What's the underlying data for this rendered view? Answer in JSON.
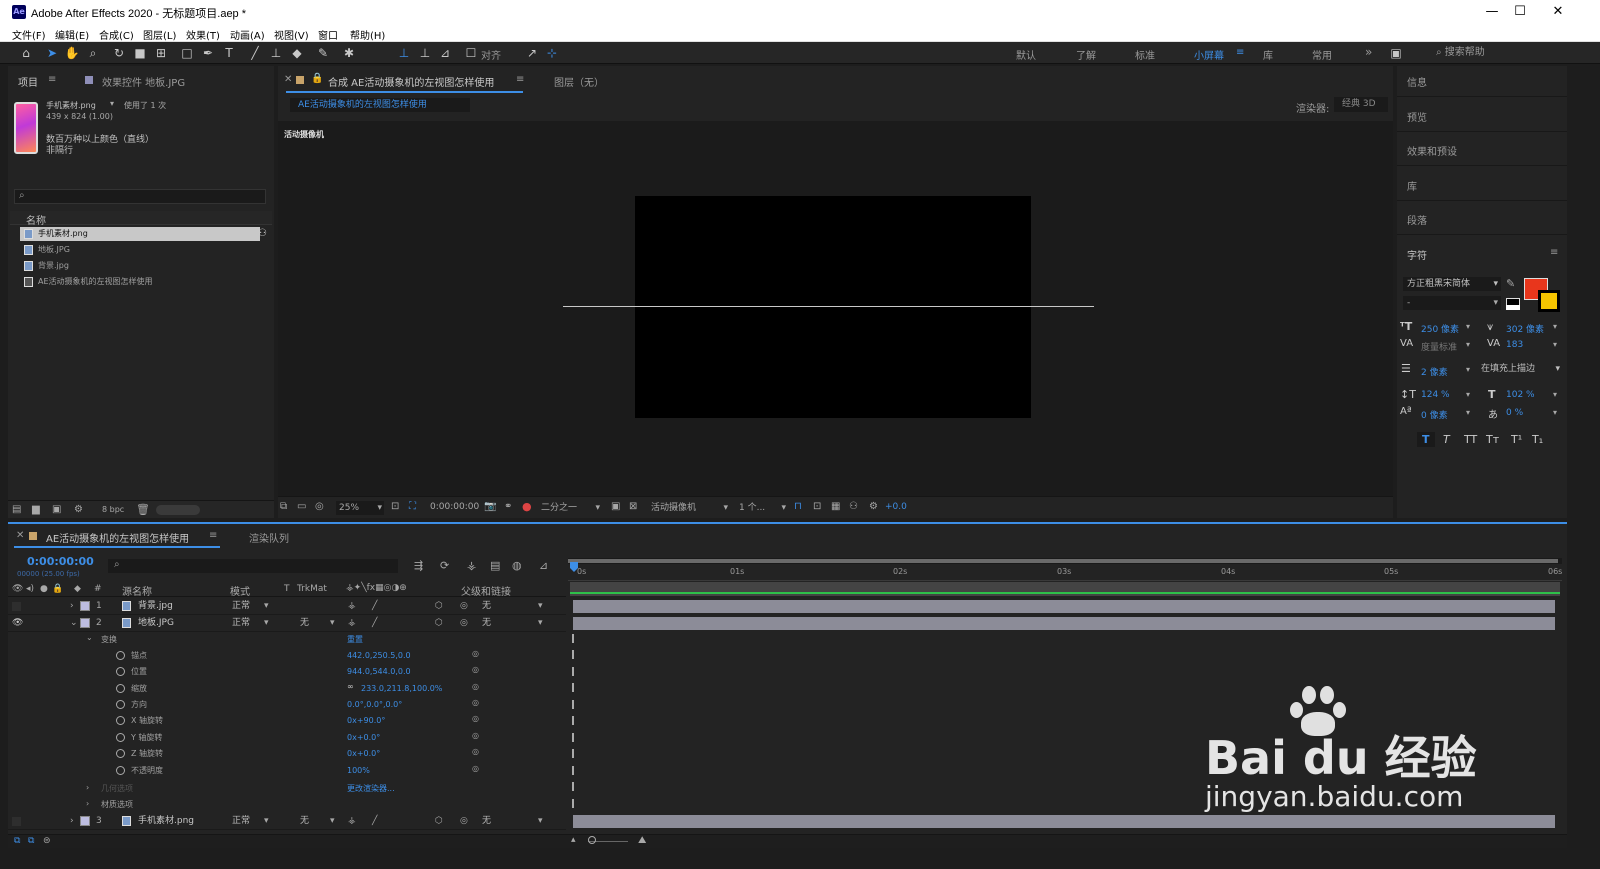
{
  "window": {
    "title": "Adobe After Effects 2020 - 无标题项目.aep *",
    "logo": "Ae",
    "minimize": "—",
    "maximize": "☐",
    "close": "✕"
  },
  "menu": [
    "文件(F)",
    "编辑(E)",
    "合成(C)",
    "图层(L)",
    "效果(T)",
    "动画(A)",
    "视图(V)",
    "窗口",
    "帮助(H)"
  ],
  "toolbar": {
    "snap_label": "对齐",
    "workspaces": [
      "默认",
      "了解",
      "标准",
      "小屏幕",
      "库",
      "常用"
    ],
    "active_workspace": "小屏幕",
    "more": "»",
    "help_placeholder": "搜索帮助"
  },
  "project_panel": {
    "tab_project": "项目",
    "tab_effects": "效果控件 地板.JPG",
    "preview_name": "手机素材.png",
    "preview_used": "使用了 1 次",
    "preview_size": "439 x 824 (1.00)",
    "preview_color": "数百万种以上颜色（直线）",
    "preview_interlace": "非隔行",
    "column_name": "名称",
    "items": [
      "手机素材.png",
      "地板.JPG",
      "背景.jpg",
      "AE活动摄象机的左视图怎样使用"
    ],
    "bpc": "8 bpc"
  },
  "viewer": {
    "tab_comp": "合成 AE活动摄象机的左视图怎样使用",
    "tab_layer": "图层（无）",
    "comp_chip": "AE活动摄象机的左视图怎样使用",
    "renderer_label": "渲染器:",
    "renderer_value": "经典 3D",
    "camera_label": "活动摄像机",
    "zoom": "25%",
    "timecode": "0:00:00:00",
    "resolution": "二分之一",
    "view_camera": "活动摄像机",
    "views": "1 个...",
    "exposure": "+0.0"
  },
  "right_panel": {
    "items": [
      "信息",
      "预览",
      "效果和预设",
      "库",
      "段落"
    ],
    "character_title": "字符",
    "font": "方正粗黑宋简体",
    "font_style": "-",
    "font_size": "250 像素",
    "leading": "302 像素",
    "kerning": "度量标准",
    "tracking": "183",
    "stroke": "2 像素",
    "stroke_mode": "在填充上描边",
    "vscale": "124 %",
    "hscale": "102 %",
    "baseline": "0 像素",
    "tsume": "0 %",
    "fill_color": "#e8361c",
    "stroke_color": "#f5c400",
    "style_buttons": [
      "T",
      "T",
      "TT",
      "Tт",
      "T¹",
      "T₁"
    ]
  },
  "timeline": {
    "tab_comp": "AE活动摄象机的左视图怎样使用",
    "tab_render": "渲染队列",
    "timecode": "0:00:00:00",
    "frames": "00000 (25.00 fps)",
    "headers": {
      "num": "#",
      "source": "源名称",
      "mode": "模式",
      "t": "T",
      "trkmat": "TrkMat",
      "parent": "父级和链接"
    },
    "layers": [
      {
        "num": "1",
        "name": "背景.jpg",
        "mode": "正常",
        "trkmat": "",
        "parent": "无"
      },
      {
        "num": "2",
        "name": "地板.JPG",
        "mode": "正常",
        "trkmat": "无",
        "parent": "无"
      },
      {
        "num": "3",
        "name": "手机素材.png",
        "mode": "正常",
        "trkmat": "无",
        "parent": "无"
      }
    ],
    "transform_label": "变换",
    "reset": "重置",
    "properties": [
      {
        "name": "锚点",
        "value": "442.0,250.5,0.0"
      },
      {
        "name": "位置",
        "value": "944.0,544.0,0.0"
      },
      {
        "name": "缩放",
        "value": "233.0,211.8,100.0%"
      },
      {
        "name": "方向",
        "value": "0.0°,0.0°,0.0°"
      },
      {
        "name": "X 轴旋转",
        "value": "0x+90.0°"
      },
      {
        "name": "Y 轴旋转",
        "value": "0x+0.0°"
      },
      {
        "name": "Z 轴旋转",
        "value": "0x+0.0°"
      },
      {
        "name": "不透明度",
        "value": "100%"
      }
    ],
    "geometry_options": "几何选项",
    "change_renderer": "更改渲染器...",
    "material_options": "材质选项",
    "ruler": [
      "0s",
      "01s",
      "02s",
      "03s",
      "04s",
      "05s",
      "06s"
    ]
  },
  "watermark": {
    "brand": "Bai du 经验",
    "url": "jingyan.baidu.com"
  }
}
